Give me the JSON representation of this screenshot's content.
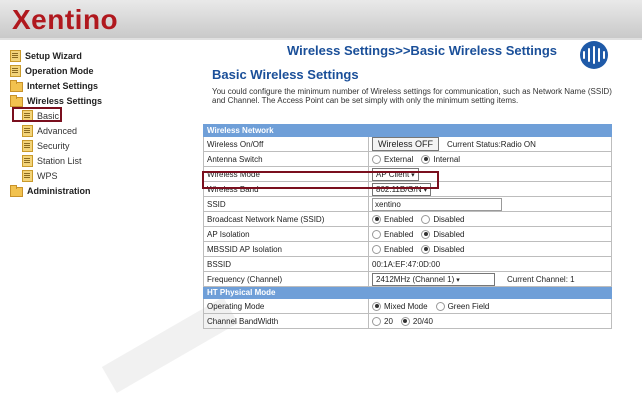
{
  "header": {
    "logo_text": "Xentino"
  },
  "sidebar": {
    "items": [
      {
        "label": "Setup Wizard",
        "icon": "page-icon"
      },
      {
        "label": "Operation Mode",
        "icon": "page-icon"
      },
      {
        "label": "Internet Settings",
        "icon": "folder-icon"
      },
      {
        "label": "Wireless Settings",
        "icon": "folder-icon"
      },
      {
        "label": "Basic",
        "icon": "page-icon"
      },
      {
        "label": "Advanced",
        "icon": "page-icon"
      },
      {
        "label": "Security",
        "icon": "page-icon"
      },
      {
        "label": "Station List",
        "icon": "page-icon"
      },
      {
        "label": "WPS",
        "icon": "page-icon"
      },
      {
        "label": "Administration",
        "icon": "folder-icon"
      }
    ]
  },
  "main": {
    "page_title": "Wireless Settings>>Basic Wireless Settings",
    "heading": "Basic Wireless Settings",
    "description": "You could configure the minimum number of Wireless settings for communication, such as Network Name (SSID) and Channel. The Access Point can be set simply with only the minimum setting items."
  },
  "form": {
    "section_wireless": "Wireless Network",
    "wireless_onoff_label": "Wireless On/Off",
    "wireless_off_button": "Wireless OFF",
    "current_status": "Current Status:Radio ON",
    "antenna_label": "Antenna Switch",
    "antenna_external": "External",
    "antenna_internal": "Internal",
    "mode_label": "Wireless Mode",
    "mode_value": "AP Client",
    "band_label": "Wireless Band",
    "band_value": "802.11B/G/N",
    "ssid_label": "SSID",
    "ssid_value": "xentino",
    "broadcast_label": "Broadcast Network Name (SSID)",
    "enabled": "Enabled",
    "disabled": "Disabled",
    "ap_isolation_label": "AP Isolation",
    "mbssid_label": "MBSSID AP Isolation",
    "bssid_label": "BSSID",
    "bssid_value": "00:1A:EF:47:0D:00",
    "freq_label": "Frequency (Channel)",
    "freq_value": "2412MHz (Channel 1)",
    "current_channel": "Current Channel: 1",
    "section_ht": "HT Physical Mode",
    "op_mode_label": "Operating Mode",
    "mixed_mode": "Mixed Mode",
    "green_field": "Green Field",
    "bandwidth_label": "Channel BandWidth",
    "bw_20": "20",
    "bw_2040": "20/40"
  },
  "colors": {
    "accent": "#1a4f99",
    "brand": "#b0181e",
    "highlight": "#7a0f1e",
    "section": "#6f9fd8"
  }
}
